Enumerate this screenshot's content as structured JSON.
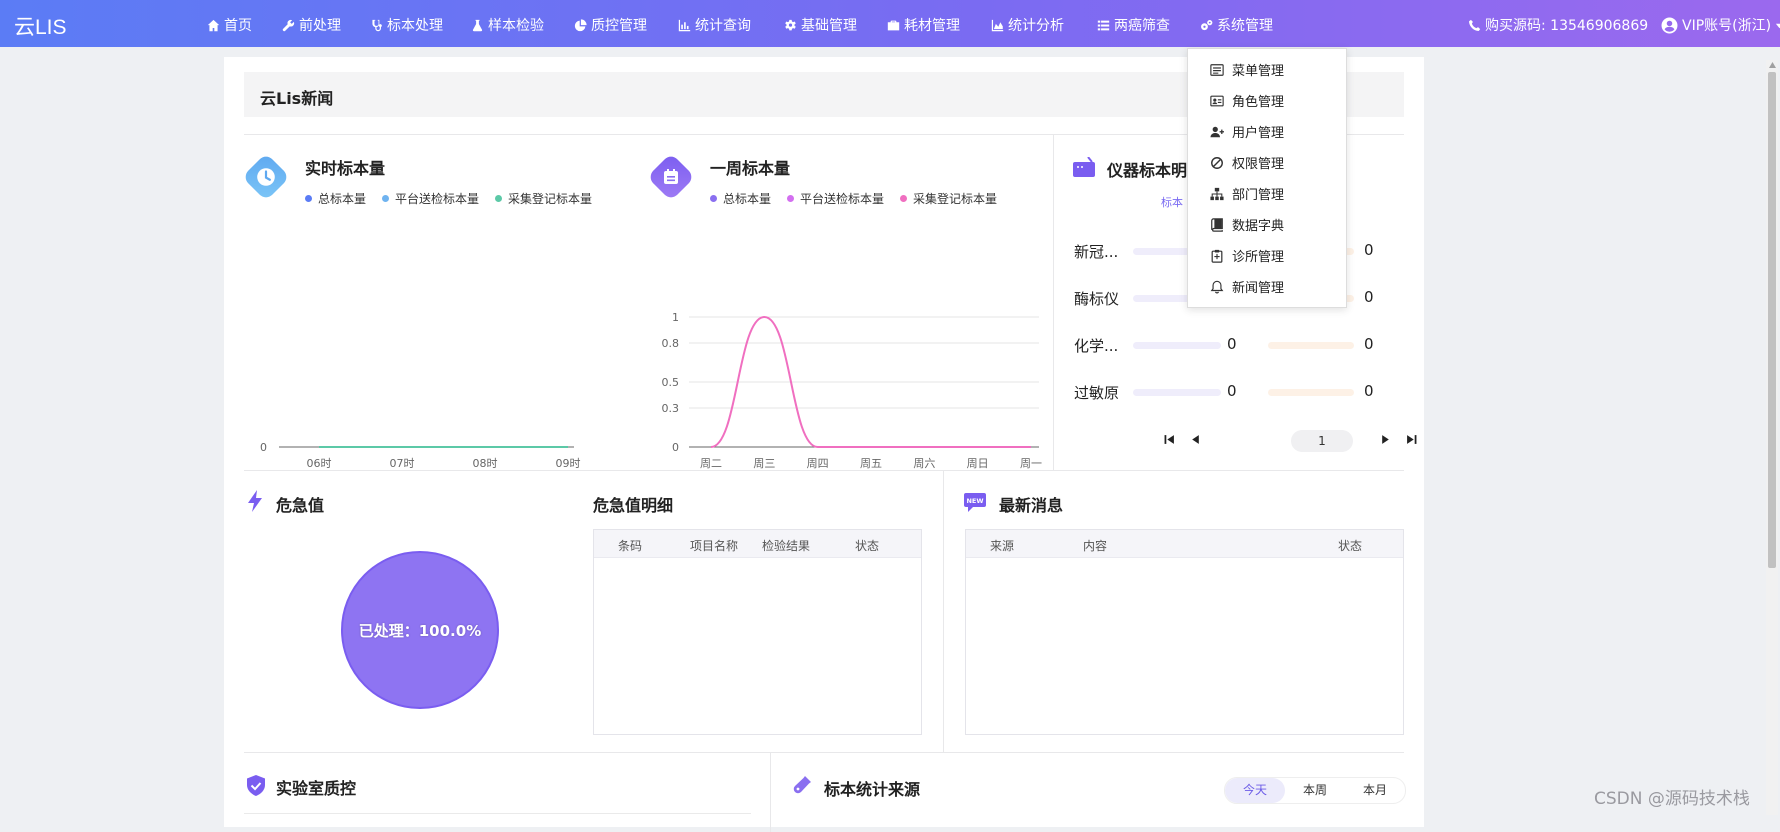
{
  "app": {
    "brand": "云LIS"
  },
  "nav": [
    {
      "label": "首页",
      "icon": "home-icon"
    },
    {
      "label": "前处理",
      "icon": "wrench-icon"
    },
    {
      "label": "标本处理",
      "icon": "stethoscope-icon"
    },
    {
      "label": "样本检验",
      "icon": "flask-icon"
    },
    {
      "label": "质控管理",
      "icon": "pie-icon"
    },
    {
      "label": "统计查询",
      "icon": "barchart-icon"
    },
    {
      "label": "基础管理",
      "icon": "gear-icon"
    },
    {
      "label": "耗材管理",
      "icon": "briefcase-icon"
    },
    {
      "label": "统计分析",
      "icon": "areachart-icon"
    },
    {
      "label": "两癌筛查",
      "icon": "list-icon"
    },
    {
      "label": "系统管理",
      "icon": "gears-icon"
    }
  ],
  "topright": {
    "buy_code": "购买源码: 13546906869",
    "account": "VIP账号(浙江)"
  },
  "news": {
    "title": "云Lis新闻"
  },
  "realtime": {
    "title": "实时标本量",
    "legend": [
      "总标本量",
      "平台送检标本量",
      "采集登记标本量"
    ],
    "colors": [
      "#5b7cf5",
      "#6fb3f0",
      "#5cc9a7"
    ],
    "y_ticks": [
      "0"
    ],
    "x_ticks": [
      "06时",
      "07时",
      "08时",
      "09时"
    ],
    "values": [
      0,
      0,
      0,
      0
    ]
  },
  "weekly": {
    "title": "一周标本量",
    "legend": [
      "总标本量",
      "平台送检标本量",
      "采集登记标本量"
    ],
    "colors": [
      "#8a6ff0",
      "#d36ff0",
      "#f06fc0"
    ],
    "y_ticks": [
      "0",
      "0.3",
      "0.5",
      "0.8",
      "1"
    ],
    "x_ticks": [
      "周二",
      "周三",
      "周四",
      "周五",
      "周六",
      "周日",
      "周一"
    ],
    "values": [
      0,
      1,
      0,
      0,
      0,
      0,
      0
    ]
  },
  "instrument": {
    "title": "仪器标本明",
    "subtitle": "标本",
    "rows": [
      {
        "name": "新冠...",
        "a": "",
        "b": "0"
      },
      {
        "name": "酶标仪",
        "a": "",
        "b": "0"
      },
      {
        "name": "化学...",
        "a": "0",
        "b": "0"
      },
      {
        "name": "过敏原",
        "a": "0",
        "b": "0"
      }
    ],
    "page": "1"
  },
  "critical": {
    "title": "危急值",
    "pie_label": "已处理：100.0%",
    "processed_fraction": 1.0,
    "detail_title": "危急值明细",
    "columns": [
      "条码",
      "项目名称",
      "检验结果",
      "状态"
    ]
  },
  "messages": {
    "title": "最新消息",
    "columns": [
      "来源",
      "内容",
      "状态"
    ]
  },
  "qc": {
    "title": "实验室质控"
  },
  "source": {
    "title": "标本统计来源",
    "tabs": [
      "今天",
      "本周",
      "本月"
    ]
  },
  "dropdown": [
    {
      "label": "菜单管理",
      "icon": "menu-icon"
    },
    {
      "label": "角色管理",
      "icon": "id-card-icon"
    },
    {
      "label": "用户管理",
      "icon": "user-plus-icon"
    },
    {
      "label": "权限管理",
      "icon": "ban-icon"
    },
    {
      "label": "部门管理",
      "icon": "sitemap-icon"
    },
    {
      "label": "数据字典",
      "icon": "book-icon"
    },
    {
      "label": "诊所管理",
      "icon": "clipboard-icon"
    },
    {
      "label": "新闻管理",
      "icon": "bell-icon"
    }
  ],
  "watermark": "CSDN @源码技术栈"
}
